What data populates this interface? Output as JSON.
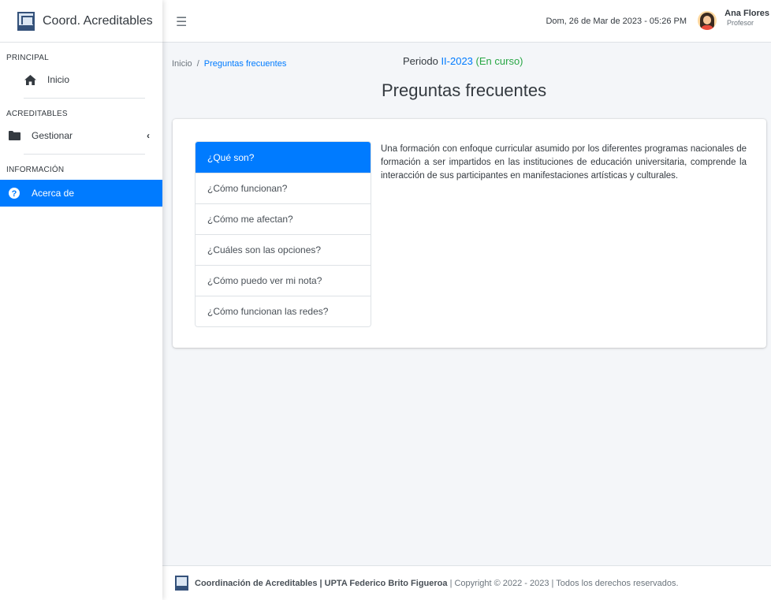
{
  "brand": {
    "title": "Coord. Acreditables"
  },
  "sidebar": {
    "sections": [
      {
        "header": "PRINCIPAL"
      },
      {
        "header": "ACREDITABLES"
      },
      {
        "header": "INFORMACIÓN"
      }
    ],
    "items": [
      {
        "label": "Inicio",
        "icon": "home-icon"
      },
      {
        "label": "Gestionar",
        "icon": "folder-icon"
      },
      {
        "label": "Acerca de",
        "icon": "question-circle-icon",
        "active": true
      }
    ]
  },
  "topbar": {
    "datetime": "Dom, 26 de Mar de 2023 - 05:26 PM",
    "user_name": "Ana Flores",
    "user_role": "Profesor"
  },
  "breadcrumb": {
    "home": "Inicio",
    "separator": "/",
    "current": "Preguntas frecuentes"
  },
  "periodo": {
    "label": "Periodo",
    "code": "II-2023",
    "status": "(En curso)"
  },
  "page_title": "Preguntas frecuentes",
  "faq": {
    "items": [
      "¿Qué son?",
      "¿Cómo funcionan?",
      "¿Cómo me afectan?",
      "¿Cuáles son las opciones?",
      "¿Cómo puedo ver mi nota?",
      "¿Cómo funcionan las redes?"
    ],
    "active_index": 0,
    "answer": "Una formación con enfoque curricular asumido por los diferentes programas nacionales de formación a ser impartidos en las instituciones de educación universitaria, comprende la interacción de sus participantes en manifestaciones artísticas y culturales."
  },
  "footer": {
    "org": "Coordinación de Acreditables | UPTA Federico Brito Figueroa",
    "copyright": "| Copyright © 2022 - 2023 | Todos los derechos reservados."
  },
  "colors": {
    "primary": "#007bff",
    "success": "#28a745",
    "text": "#343a40",
    "background": "#f4f6f9"
  }
}
